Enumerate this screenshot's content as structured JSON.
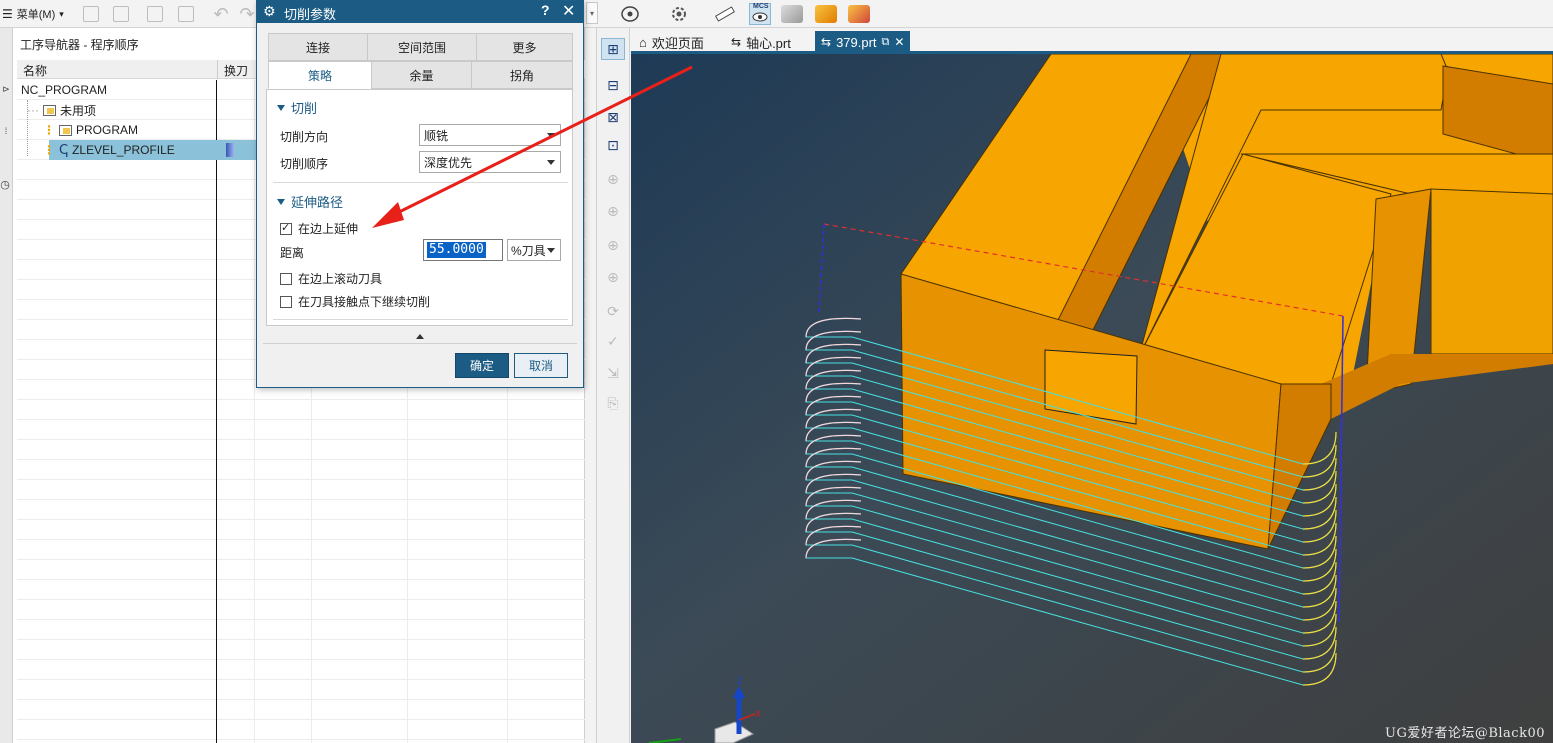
{
  "toolbar": {
    "menu_label": "菜单(M)",
    "menu_arrow": "▾",
    "icons": [
      "new-part-icon",
      "open-icon",
      "save-icon",
      "save-as-icon",
      "undo-icon",
      "redo-icon",
      "view-triad-icon",
      "settings-icon",
      "measure-icon",
      "mcs-icon",
      "tool-icon",
      "geometry-icon",
      "method-icon"
    ],
    "mcs_label": "MCS"
  },
  "navigator": {
    "title": "工序导航器 - 程序顺序",
    "columns": {
      "name": "名称",
      "tool_change": "换刀"
    },
    "tree": [
      {
        "label": "NC_PROGRAM",
        "icon": ""
      },
      {
        "label": "未用项",
        "icon": "folder-icon"
      },
      {
        "label": "PROGRAM",
        "icon": "folder-icon"
      },
      {
        "label": "ZLEVEL_PROFILE",
        "icon": "zlevel-operation-icon",
        "selected": true
      }
    ]
  },
  "dialog": {
    "title": "切削参数",
    "help": "?",
    "close": "✕",
    "tabs_row1": [
      "连接",
      "空间范围",
      "更多"
    ],
    "tabs_row2": [
      "策略",
      "余量",
      "拐角"
    ],
    "active_tab": "策略",
    "section_cut": {
      "title": "切削",
      "cut_direction_label": "切削方向",
      "cut_direction_value": "顺铣",
      "cut_order_label": "切削顺序",
      "cut_order_value": "深度优先"
    },
    "section_extend": {
      "title": "延伸路径",
      "extend_on_edge_label": "在边上延伸",
      "extend_on_edge_checked": true,
      "distance_label": "距离",
      "distance_value": "55.0000",
      "distance_unit": "%刀具",
      "roll_tool_label": "在边上滚动刀具",
      "roll_tool_checked": false,
      "continue_cut_label": "在刀具接触点下继续切削",
      "continue_cut_checked": false
    },
    "ok_label": "确定",
    "cancel_label": "取消"
  },
  "tabs": [
    {
      "label": "欢迎页面",
      "icon": "home-icon",
      "active": false
    },
    {
      "label": "轴心.prt",
      "icon": "part-icon",
      "active": false
    },
    {
      "label": "379.prt",
      "icon": "part-icon",
      "active": true,
      "close": "✕"
    }
  ],
  "viewport": {
    "axis_x": "X",
    "axis_z": "Z",
    "model_color": "#f7a500",
    "background_top": "#1e3a56",
    "background_bottom": "#3d3d3d",
    "toolpath_cyan": "#47e0e0",
    "toolpath_yellow": "#f2dc3c",
    "toolpath_pink": "#f5d6da"
  },
  "watermark": "UG爱好者论坛@Black00"
}
